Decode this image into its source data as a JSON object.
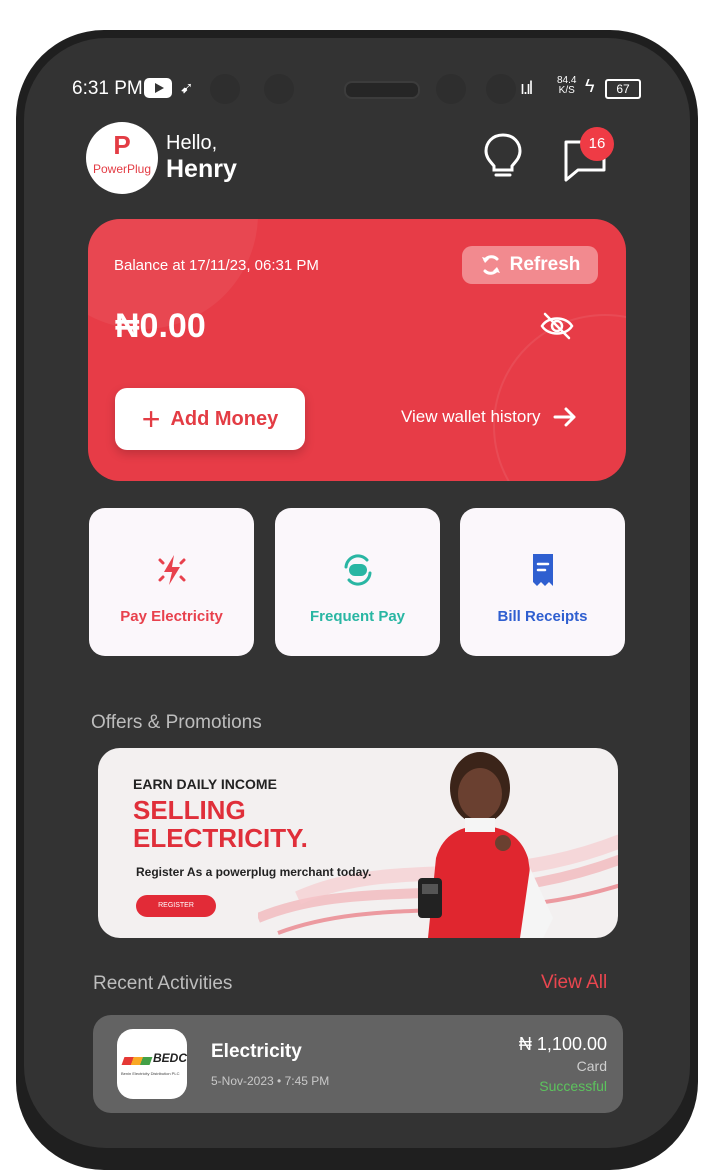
{
  "status_bar": {
    "time": "6:31 PM",
    "net_speed_value": "84.4",
    "net_speed_unit": "K/S",
    "battery": "67"
  },
  "header": {
    "avatar_logo_letter": "P",
    "avatar_logo_text": "PowerPlug",
    "greeting": "Hello,",
    "user_name": "Henry",
    "notification_count": "16"
  },
  "balance_card": {
    "label": "Balance at 17/11/23, 06:31 PM",
    "refresh_label": "Refresh",
    "amount": "₦0.00",
    "add_money_label": "Add Money",
    "wallet_history_label": "View wallet history"
  },
  "actions": [
    {
      "label": "Pay Electricity",
      "color": "#e8414d",
      "icon": "flash-icon"
    },
    {
      "label": "Frequent Pay",
      "color": "#29b6a3",
      "icon": "repeat-icon"
    },
    {
      "label": "Bill Receipts",
      "color": "#2f5fd0",
      "icon": "receipt-icon"
    }
  ],
  "offers": {
    "section_title": "Offers & Promotions",
    "promo_kicker": "EARN DAILY INCOME",
    "promo_headline_line1": "SELLING",
    "promo_headline_line2": "ELECTRICITY.",
    "promo_sub": "Register As a powerplug merchant today.",
    "promo_button": "REGISTER"
  },
  "recent": {
    "section_title": "Recent Activities",
    "view_all_label": "View All",
    "items": [
      {
        "logo_text": "BEDC",
        "logo_subtext": "Benin Electricity Distribution PLC",
        "title": "Electricity",
        "date": "5-Nov-2023 • 7:45 PM",
        "amount": "₦ 1,100.00",
        "method": "Card",
        "status": "Successful"
      }
    ]
  },
  "colors": {
    "accent": "#e73c47",
    "background": "#333333",
    "success": "#5cc35d"
  }
}
